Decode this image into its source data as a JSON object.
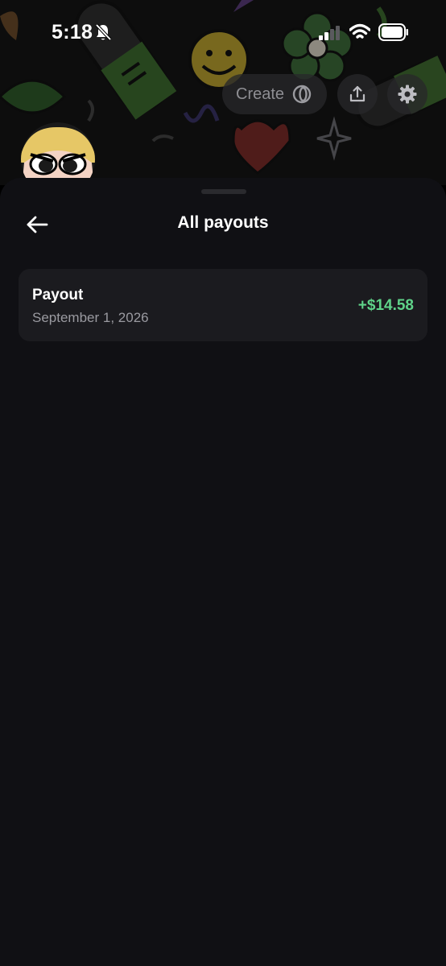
{
  "status_bar": {
    "time": "5:18",
    "icons": [
      "bell-slash-icon",
      "cellular-signal-icon",
      "wifi-icon",
      "battery-icon"
    ]
  },
  "header": {
    "create_label": "Create",
    "create_icon": "coin-icon",
    "share_icon": "share-icon",
    "settings_icon": "gear-icon"
  },
  "sheet": {
    "title": "All payouts",
    "back_icon": "arrow-left-icon",
    "payouts": [
      {
        "title": "Payout",
        "date": "September 1, 2026",
        "amount": "+$14.58"
      }
    ]
  },
  "colors": {
    "sheet_background": "#101014",
    "card_background": "#1b1b1f",
    "amount_positive": "#5fd389",
    "secondary_text": "#9a9aa0",
    "pill_text": "#8e8e93"
  }
}
